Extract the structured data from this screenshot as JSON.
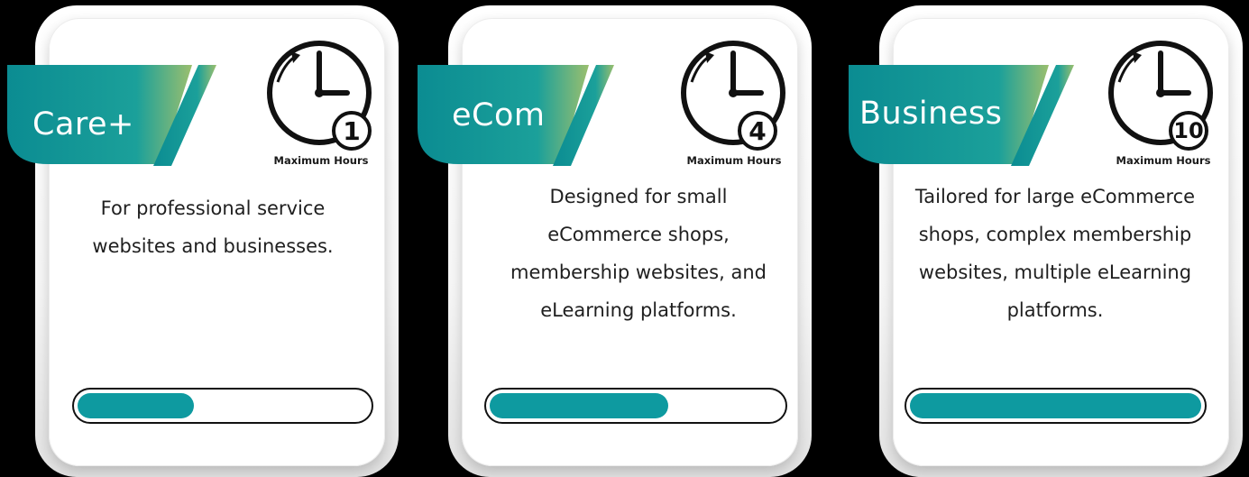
{
  "plans": [
    {
      "name": "Care+",
      "hours": "1",
      "hours_label": "Maximum Hours",
      "description": "For professional service websites and businesses.",
      "usage_fraction": 0.4
    },
    {
      "name": "eCom",
      "hours": "4",
      "hours_label": "Maximum Hours",
      "description": "Designed for small eCommerce shops, membership websites, and eLearning platforms.",
      "usage_fraction": 0.61
    },
    {
      "name": "Business",
      "hours": "10",
      "hours_label": "Maximum Hours",
      "description": "Tailored for large eCommerce shops, complex membership websites, multiple eLearning platforms.",
      "usage_fraction": 1.0
    }
  ],
  "colors": {
    "accent_teal": "#0e9aa0",
    "banner_gradient_start": "#0b8c92",
    "banner_gradient_end": "#9bbf6e"
  },
  "icons": {
    "clock": "clock-icon"
  }
}
